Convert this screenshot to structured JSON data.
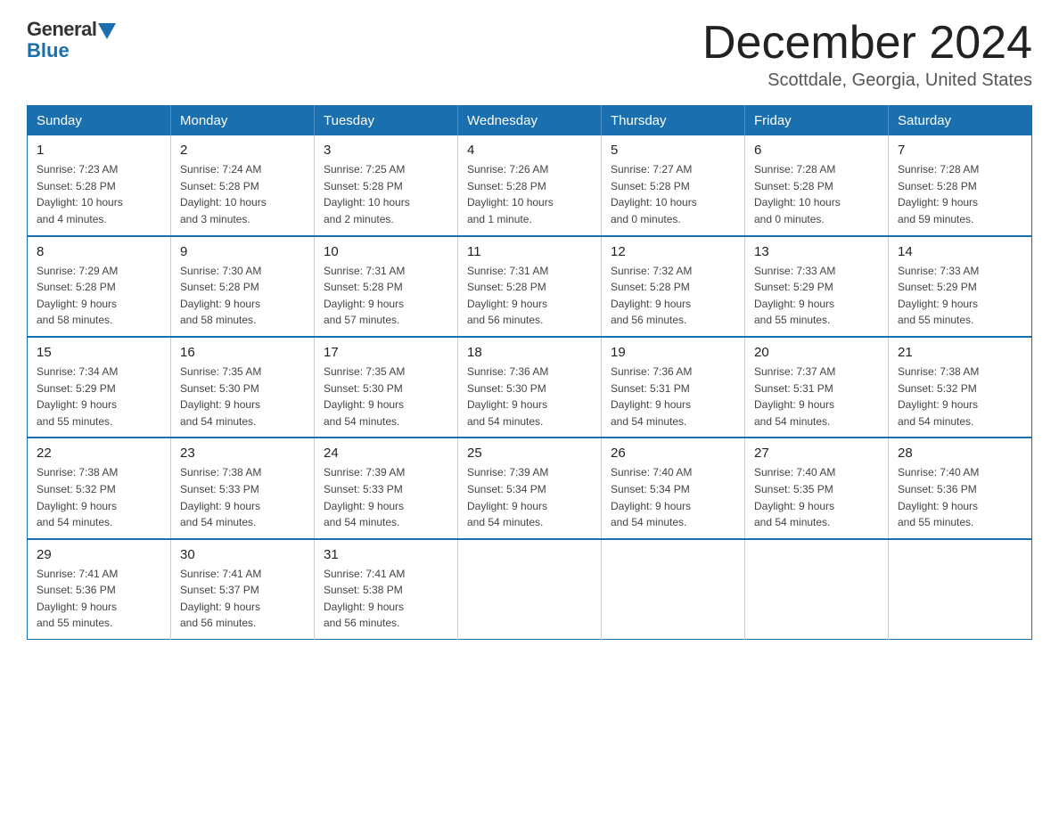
{
  "logo": {
    "general": "General",
    "blue": "Blue"
  },
  "title": "December 2024",
  "location": "Scottdale, Georgia, United States",
  "days_of_week": [
    "Sunday",
    "Monday",
    "Tuesday",
    "Wednesday",
    "Thursday",
    "Friday",
    "Saturday"
  ],
  "weeks": [
    [
      {
        "day": "1",
        "info": "Sunrise: 7:23 AM\nSunset: 5:28 PM\nDaylight: 10 hours\nand 4 minutes."
      },
      {
        "day": "2",
        "info": "Sunrise: 7:24 AM\nSunset: 5:28 PM\nDaylight: 10 hours\nand 3 minutes."
      },
      {
        "day": "3",
        "info": "Sunrise: 7:25 AM\nSunset: 5:28 PM\nDaylight: 10 hours\nand 2 minutes."
      },
      {
        "day": "4",
        "info": "Sunrise: 7:26 AM\nSunset: 5:28 PM\nDaylight: 10 hours\nand 1 minute."
      },
      {
        "day": "5",
        "info": "Sunrise: 7:27 AM\nSunset: 5:28 PM\nDaylight: 10 hours\nand 0 minutes."
      },
      {
        "day": "6",
        "info": "Sunrise: 7:28 AM\nSunset: 5:28 PM\nDaylight: 10 hours\nand 0 minutes."
      },
      {
        "day": "7",
        "info": "Sunrise: 7:28 AM\nSunset: 5:28 PM\nDaylight: 9 hours\nand 59 minutes."
      }
    ],
    [
      {
        "day": "8",
        "info": "Sunrise: 7:29 AM\nSunset: 5:28 PM\nDaylight: 9 hours\nand 58 minutes."
      },
      {
        "day": "9",
        "info": "Sunrise: 7:30 AM\nSunset: 5:28 PM\nDaylight: 9 hours\nand 58 minutes."
      },
      {
        "day": "10",
        "info": "Sunrise: 7:31 AM\nSunset: 5:28 PM\nDaylight: 9 hours\nand 57 minutes."
      },
      {
        "day": "11",
        "info": "Sunrise: 7:31 AM\nSunset: 5:28 PM\nDaylight: 9 hours\nand 56 minutes."
      },
      {
        "day": "12",
        "info": "Sunrise: 7:32 AM\nSunset: 5:28 PM\nDaylight: 9 hours\nand 56 minutes."
      },
      {
        "day": "13",
        "info": "Sunrise: 7:33 AM\nSunset: 5:29 PM\nDaylight: 9 hours\nand 55 minutes."
      },
      {
        "day": "14",
        "info": "Sunrise: 7:33 AM\nSunset: 5:29 PM\nDaylight: 9 hours\nand 55 minutes."
      }
    ],
    [
      {
        "day": "15",
        "info": "Sunrise: 7:34 AM\nSunset: 5:29 PM\nDaylight: 9 hours\nand 55 minutes."
      },
      {
        "day": "16",
        "info": "Sunrise: 7:35 AM\nSunset: 5:30 PM\nDaylight: 9 hours\nand 54 minutes."
      },
      {
        "day": "17",
        "info": "Sunrise: 7:35 AM\nSunset: 5:30 PM\nDaylight: 9 hours\nand 54 minutes."
      },
      {
        "day": "18",
        "info": "Sunrise: 7:36 AM\nSunset: 5:30 PM\nDaylight: 9 hours\nand 54 minutes."
      },
      {
        "day": "19",
        "info": "Sunrise: 7:36 AM\nSunset: 5:31 PM\nDaylight: 9 hours\nand 54 minutes."
      },
      {
        "day": "20",
        "info": "Sunrise: 7:37 AM\nSunset: 5:31 PM\nDaylight: 9 hours\nand 54 minutes."
      },
      {
        "day": "21",
        "info": "Sunrise: 7:38 AM\nSunset: 5:32 PM\nDaylight: 9 hours\nand 54 minutes."
      }
    ],
    [
      {
        "day": "22",
        "info": "Sunrise: 7:38 AM\nSunset: 5:32 PM\nDaylight: 9 hours\nand 54 minutes."
      },
      {
        "day": "23",
        "info": "Sunrise: 7:38 AM\nSunset: 5:33 PM\nDaylight: 9 hours\nand 54 minutes."
      },
      {
        "day": "24",
        "info": "Sunrise: 7:39 AM\nSunset: 5:33 PM\nDaylight: 9 hours\nand 54 minutes."
      },
      {
        "day": "25",
        "info": "Sunrise: 7:39 AM\nSunset: 5:34 PM\nDaylight: 9 hours\nand 54 minutes."
      },
      {
        "day": "26",
        "info": "Sunrise: 7:40 AM\nSunset: 5:34 PM\nDaylight: 9 hours\nand 54 minutes."
      },
      {
        "day": "27",
        "info": "Sunrise: 7:40 AM\nSunset: 5:35 PM\nDaylight: 9 hours\nand 54 minutes."
      },
      {
        "day": "28",
        "info": "Sunrise: 7:40 AM\nSunset: 5:36 PM\nDaylight: 9 hours\nand 55 minutes."
      }
    ],
    [
      {
        "day": "29",
        "info": "Sunrise: 7:41 AM\nSunset: 5:36 PM\nDaylight: 9 hours\nand 55 minutes."
      },
      {
        "day": "30",
        "info": "Sunrise: 7:41 AM\nSunset: 5:37 PM\nDaylight: 9 hours\nand 56 minutes."
      },
      {
        "day": "31",
        "info": "Sunrise: 7:41 AM\nSunset: 5:38 PM\nDaylight: 9 hours\nand 56 minutes."
      },
      null,
      null,
      null,
      null
    ]
  ]
}
